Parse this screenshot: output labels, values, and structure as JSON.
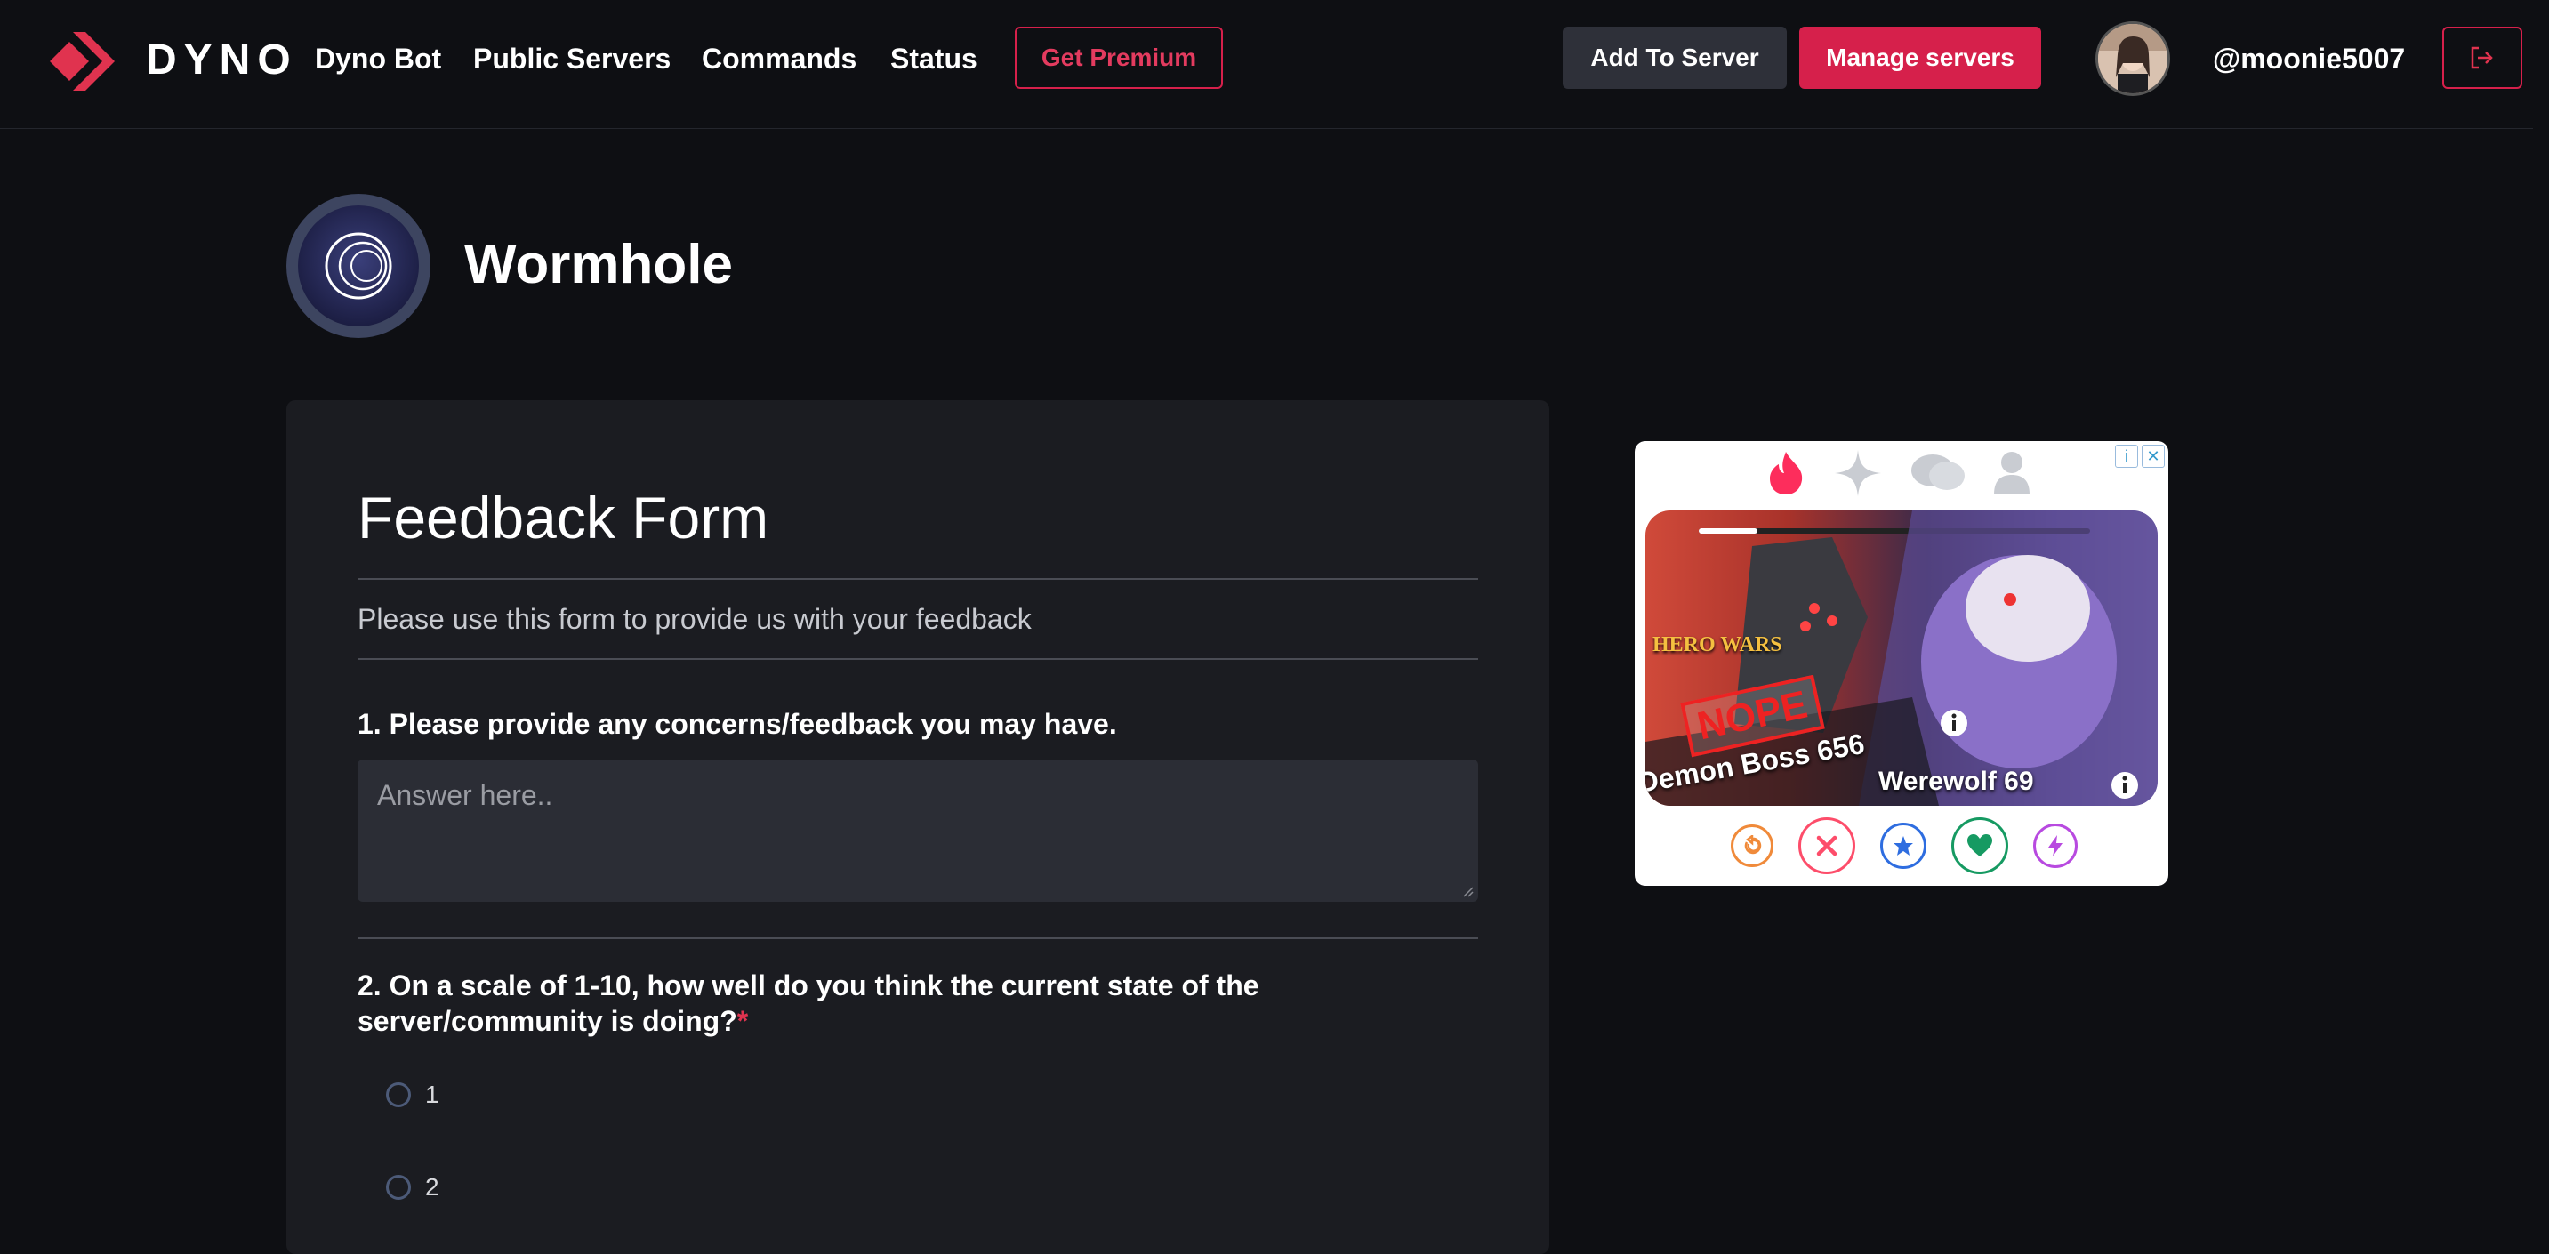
{
  "nav": {
    "brand": "DYNO",
    "links": [
      "Dyno Bot",
      "Public Servers",
      "Commands",
      "Status"
    ],
    "premium_label": "Get Premium",
    "add_label": "Add To Server",
    "manage_label": "Manage servers",
    "username": "@moonie5007",
    "logout_icon": "logout-icon",
    "accent_color": "#d6204b"
  },
  "server": {
    "name": "Wormhole",
    "icon": "wormhole-spiral-icon"
  },
  "form": {
    "title": "Feedback Form",
    "description": "Please use this form to provide us with your feedback",
    "questions": [
      {
        "label": "1. Please provide any concerns/feedback you may have.",
        "placeholder": "Answer here..",
        "value": ""
      },
      {
        "label": "2. On a scale of 1-10, how well do you think the current state of the server/community is doing?",
        "required_mark": "*",
        "options": [
          "1",
          "2"
        ]
      }
    ]
  },
  "ad": {
    "badges": [
      "i",
      "✕"
    ],
    "brand": "HERO WARS",
    "stamp": "NOPE",
    "card_left": "Demon Boss 656",
    "card_right": "Werewolf 69",
    "progress": 0.15,
    "actions": [
      "rewind-icon",
      "close-icon",
      "star-icon",
      "heart-icon",
      "bolt-icon"
    ]
  }
}
